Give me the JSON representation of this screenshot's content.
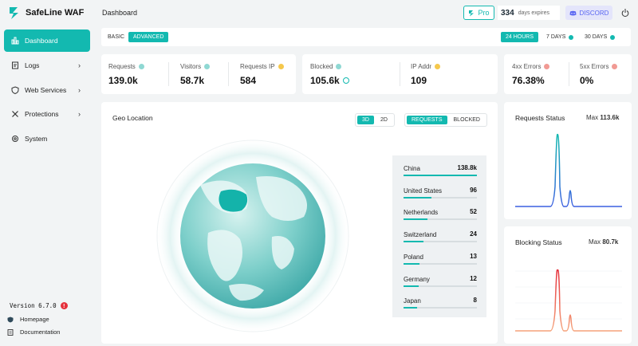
{
  "app": {
    "name": "SafeLine WAF",
    "version": "Version 6.7.0"
  },
  "sidebar": {
    "items": [
      {
        "label": "Dashboard",
        "icon": "chart-icon",
        "active": true
      },
      {
        "label": "Logs",
        "icon": "log-icon",
        "has_children": true
      },
      {
        "label": "Web Services",
        "icon": "shield-icon",
        "has_children": true
      },
      {
        "label": "Protections",
        "icon": "tools-icon",
        "has_children": true
      },
      {
        "label": "System",
        "icon": "gear-icon"
      }
    ],
    "footer": [
      {
        "label": "Homepage",
        "icon": "shield-home-icon"
      },
      {
        "label": "Documentation",
        "icon": "doc-icon"
      }
    ]
  },
  "header": {
    "title": "Dashboard",
    "pro_label": "Pro",
    "days": "334",
    "days_label": "days expires",
    "discord_label": "DISCORD"
  },
  "filters": {
    "modes": [
      "BASIC",
      "ADVANCED"
    ],
    "active_mode": "ADVANCED",
    "ranges": [
      "24 HOURS",
      "7 DAYS",
      "30 DAYS"
    ],
    "active_range": "24 HOURS"
  },
  "stats": {
    "requests": {
      "label": "Requests",
      "value": "139.0k"
    },
    "visitors": {
      "label": "Visitors",
      "value": "58.7k"
    },
    "requests_ip": {
      "label": "Requests IP",
      "value": "584"
    },
    "blocked": {
      "label": "Blocked",
      "value": "105.6k"
    },
    "ip_addr": {
      "label": "IP Addr",
      "value": "109"
    },
    "errors_4xx": {
      "label": "4xx Errors",
      "value": "76.38%"
    },
    "errors_5xx": {
      "label": "5xx Errors",
      "value": "0%"
    }
  },
  "geo": {
    "title": "Geo Location",
    "view_modes": [
      "3D",
      "2D"
    ],
    "active_view": "3D",
    "metrics": [
      "REQUESTS",
      "BLOCKED"
    ],
    "active_metric": "REQUESTS",
    "countries": [
      {
        "name": "China",
        "value": "138.8k",
        "fraction": 1.0
      },
      {
        "name": "United States",
        "value": "96",
        "fraction": 0.38
      },
      {
        "name": "Netherlands",
        "value": "52",
        "fraction": 0.33
      },
      {
        "name": "Switzerland",
        "value": "24",
        "fraction": 0.27
      },
      {
        "name": "Poland",
        "value": "13",
        "fraction": 0.22
      },
      {
        "name": "Germany",
        "value": "12",
        "fraction": 0.21
      },
      {
        "name": "Japan",
        "value": "8",
        "fraction": 0.18
      }
    ]
  },
  "requests_status": {
    "title": "Requests Status",
    "max_label": "Max",
    "max_value": "113.6k",
    "color": "#3b5fe0"
  },
  "blocking_status": {
    "title": "Blocking Status",
    "max_label": "Max",
    "max_value": "80.7k",
    "color": "#f07b70"
  },
  "colors": {
    "accent": "#13b9b0",
    "discord": "#5865f2",
    "warn": "#e5303b"
  }
}
